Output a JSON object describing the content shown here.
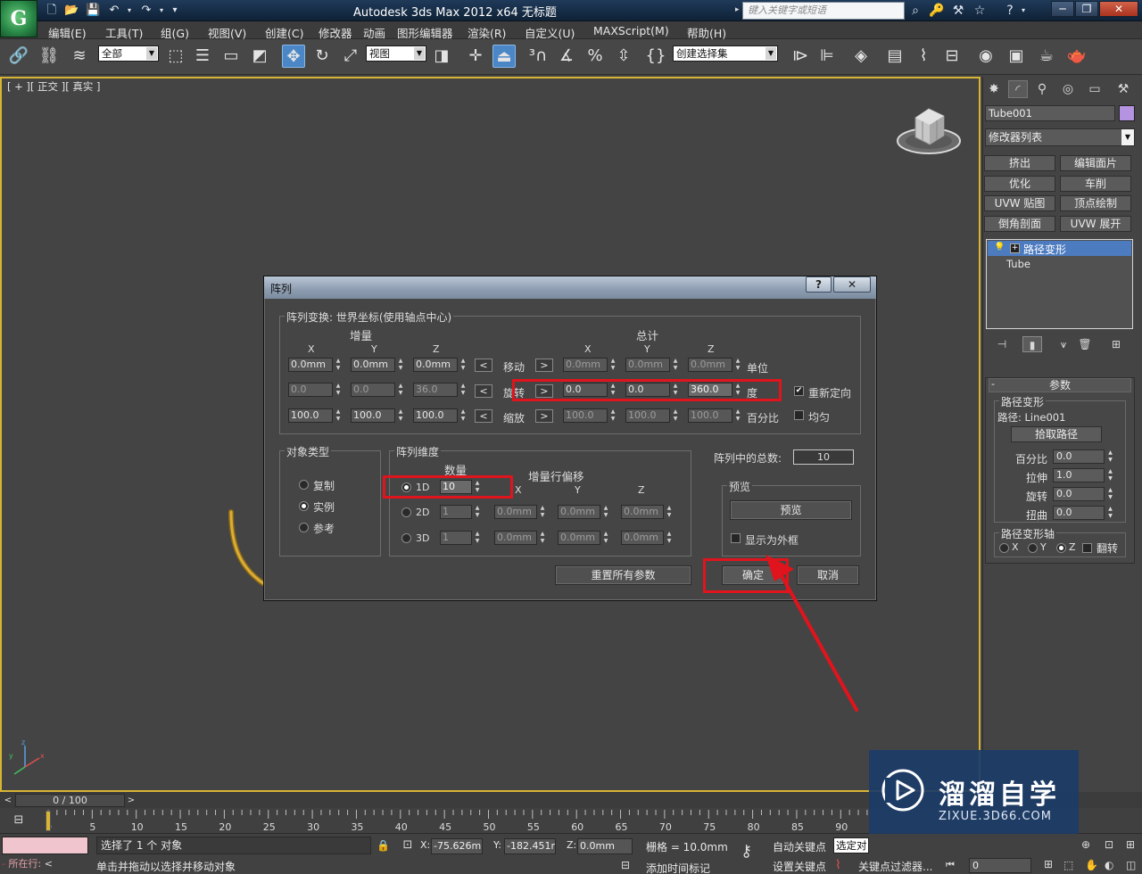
{
  "window": {
    "title": "Autodesk 3ds Max  2012 x64      无标题",
    "search_placeholder": "键入关键字或短语",
    "app_logo": "G"
  },
  "menu": [
    "编辑(E)",
    "工具(T)",
    "组(G)",
    "视图(V)",
    "创建(C)",
    "修改器",
    "动画",
    "图形编辑器",
    "渲染(R)",
    "自定义(U)",
    "MAXScript(M)",
    "帮助(H)"
  ],
  "toolbar": {
    "selection_filter": "全部",
    "reference_coord": "视图",
    "named_selection": "创建选择集"
  },
  "viewport": {
    "label": "[ + ][ 正交 ][ 真实 ]"
  },
  "command_panel": {
    "object_name": "Tube001",
    "modifier_list": "修改器列表",
    "modifier_buttons": [
      "挤出",
      "编辑面片",
      "优化",
      "车削",
      "UVW 贴图",
      "顶点绘制",
      "倒角剖面",
      "UVW 展开"
    ],
    "stack_top": "路径变形",
    "stack_base": "Tube",
    "params_title": "参数",
    "path_group_title": "路径变形",
    "path_label": "路径: Line001",
    "pick_path": "拾取路径",
    "fields": [
      {
        "label": "百分比",
        "value": "0.0"
      },
      {
        "label": "拉伸",
        "value": "1.0"
      },
      {
        "label": "旋转",
        "value": "0.0"
      },
      {
        "label": "扭曲",
        "value": "0.0"
      }
    ],
    "axis_group_title": "路径变形轴",
    "axis_options": [
      "X",
      "Y",
      "Z"
    ],
    "flip_label": "翻转"
  },
  "dialog": {
    "title": "阵列",
    "help_btn": "?",
    "close_btn": "✕",
    "transform_title": "阵列变换: 世界坐标(使用轴点中心)",
    "increments_header": "增量",
    "totals_header": "总计",
    "axis_x": "X",
    "axis_y": "Y",
    "axis_z": "Z",
    "move_label": "移动",
    "rotate_label": "旋转",
    "scale_label": "缩放",
    "unit_label": "单位",
    "degree_label": "度",
    "percent_label": "百分比",
    "move_inc": [
      "0.0mm",
      "0.0mm",
      "0.0mm"
    ],
    "rotate_inc": [
      "0.0",
      "0.0",
      "36.0"
    ],
    "scale_inc": [
      "100.0",
      "100.0",
      "100.0"
    ],
    "move_total": [
      "0.0mm",
      "0.0mm",
      "0.0mm"
    ],
    "rotate_total": [
      "0.0",
      "0.0",
      "360.0"
    ],
    "scale_total": [
      "100.0",
      "100.0",
      "100.0"
    ],
    "left_arrow": "<",
    "right_arrow": ">",
    "reorient_label": "重新定向",
    "uniform_label": "均匀",
    "object_type_title": "对象类型",
    "copy_label": "复制",
    "instance_label": "实例",
    "reference_label": "参考",
    "dimensions_title": "阵列维度",
    "count_header": "数量",
    "row_offset_header": "增量行偏移",
    "dim_1d": "1D",
    "dim_2d": "2D",
    "dim_3d": "3D",
    "count_1d": "10",
    "count_2d": "1",
    "count_3d": "1",
    "offset_2d": [
      "0.0mm",
      "0.0mm",
      "0.0mm"
    ],
    "offset_3d": [
      "0.0mm",
      "0.0mm",
      "0.0mm"
    ],
    "total_label": "阵列中的总数:",
    "total_value": "10",
    "preview_title": "预览",
    "preview_btn": "预览",
    "show_box_label": "显示为外框",
    "reset_btn": "重置所有参数",
    "ok_btn": "确定",
    "cancel_btn": "取消"
  },
  "timeline": {
    "frame_display": "0 / 100",
    "ticks": [
      "0",
      "5",
      "10",
      "15",
      "20",
      "25",
      "30",
      "35",
      "40",
      "45",
      "50",
      "55",
      "60",
      "65",
      "70",
      "75",
      "80",
      "85",
      "90"
    ]
  },
  "status": {
    "listener": "所在行:",
    "selection_text": "选择了 1 个 对象",
    "prompt": "单击并拖动以选择并移动对象",
    "x_label": "X:",
    "x_value": "-75.626mm",
    "y_label": "Y:",
    "y_value": "-182.451m",
    "z_label": "Z:",
    "z_value": "0.0mm",
    "grid": "栅格 = 10.0mm",
    "add_time_tag": "添加时间标记",
    "auto_key": "自动关键点",
    "set_key": "设置关键点",
    "selected_dropdown": "选定对",
    "key_filters": "关键点过滤器...",
    "frame_field": "0"
  },
  "watermark": {
    "title": "溜溜自学",
    "url": "ZIXUE.3D66.COM"
  },
  "colors": {
    "highlight": "#e0141c",
    "viewport_border": "#d9b534",
    "accent_blue": "#4d7bbf"
  }
}
